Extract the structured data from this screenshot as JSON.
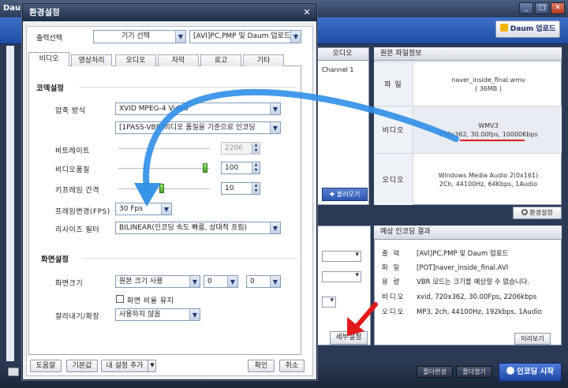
{
  "background_app": {
    "title": "Dau",
    "upload_button": "Daum 업로드",
    "list_header": "오디오",
    "list_cell": "Channel 1",
    "load_button": "불러오기",
    "source_info": {
      "header": "원본 파일정보",
      "file_key": "파 일",
      "file_line1": "naver_inside_final.wmv",
      "file_line2": "( 36MB )",
      "video_key": "비디오",
      "video_line1": "WMV3",
      "video_line2": "720x362, 30.00fps, 10000Kbps",
      "audio_key": "오디오",
      "audio_line1": "Windows Media Audio 2(0x161)",
      "audio_line2": "2Ch, 44100Hz, 64Kbps, 1Audio"
    },
    "settings_button": "환경설정",
    "detail_button": "세부설정",
    "estimate": {
      "header": "예상 인코딩 결과",
      "rows": [
        {
          "k": "출 력",
          "v": "[AVI]PC,PMP 및 Daum 업로드"
        },
        {
          "k": "파 일",
          "v": "[POT]naver_inside_final.AVI"
        },
        {
          "k": "용 량",
          "v": "VBR 모드는 크기를 예상할 수 없습니다."
        },
        {
          "k": "비디오",
          "v": "xvid, 720x362, 30.00Fps, 2206kbps"
        },
        {
          "k": "오디오",
          "v": "MP3, 2ch, 44100Hz, 192kbps, 1Audio"
        }
      ]
    },
    "preview_button": "미리보기",
    "folder_change": "폴더변경",
    "folder_open": "폴더열기",
    "encode_button": "인코딩 시작"
  },
  "dialog": {
    "title": "환경설정",
    "output_label": "출력선택",
    "device_select": "기기 선택",
    "format_select": "[AVI]PC,PMP 및 Daum 업로드",
    "tabs": [
      "비디오",
      "영상처리",
      "오디오",
      "자막",
      "로고",
      "기타"
    ],
    "codec_section": "코덱설정",
    "compression_label": "압축 방식",
    "compression_value": "XVID MPEG-4 Video",
    "pass_value": "[1PASS-VBR]비디오 품질을 기준으로 인코딩",
    "bitrate_label": "비트레이트",
    "bitrate_value": "2206",
    "quality_label": "비디오품질",
    "quality_value": "100",
    "keyframe_label": "키프레임 간격",
    "keyframe_value": "10",
    "fps_label": "프레임변경(FPS)",
    "fps_value": "30 Fps",
    "resize_label": "리사이즈 필터",
    "resize_value": "BILINEAR(인코딩 속도 빠름, 상대적 흐림)",
    "screen_section": "화면설정",
    "screen_size_label": "화면크기",
    "screen_size_value": "원본 크기 사용",
    "width_value": "0",
    "height_value": "0",
    "keep_ratio_label": "화면 비율 유지",
    "crop_label": "잘라내기/확장",
    "crop_value": "사용하지 않음",
    "help_button": "도움말",
    "default_button": "기본값",
    "add_setting_button": "내 설정 추가",
    "ok_button": "확인",
    "cancel_button": "취소"
  },
  "colors": {
    "annotation_blue": "#2f8fe8",
    "annotation_red": "#e0191b",
    "titlebar": "#2b3c5b"
  }
}
